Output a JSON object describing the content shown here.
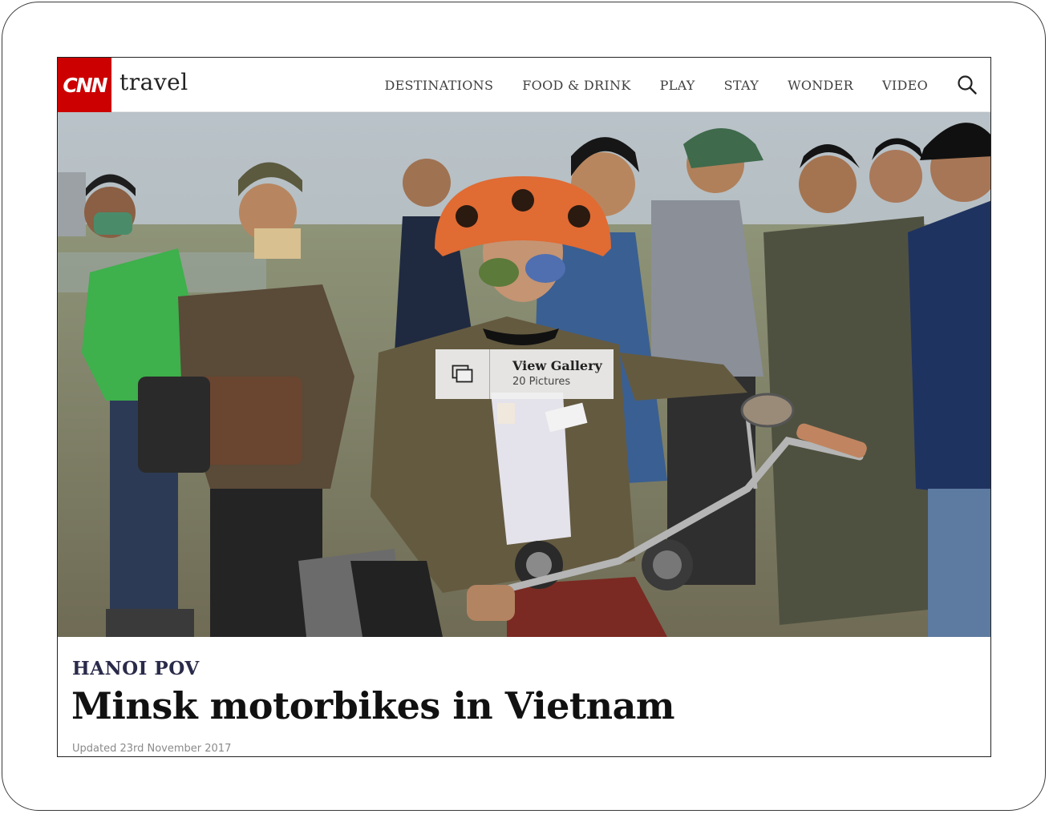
{
  "brand": {
    "logo_text": "CNN",
    "section_name": "travel",
    "accent_color": "#cc0000"
  },
  "nav": {
    "items": [
      {
        "label": "DESTINATIONS"
      },
      {
        "label": "FOOD & DRINK"
      },
      {
        "label": "PLAY"
      },
      {
        "label": "STAY"
      },
      {
        "label": "WONDER"
      },
      {
        "label": "VIDEO"
      }
    ],
    "search_icon": "search-icon"
  },
  "hero": {
    "gallery": {
      "icon": "gallery-icon",
      "title": "View Gallery",
      "count": "20 Pictures"
    }
  },
  "article": {
    "kicker": "HANOI POV",
    "kicker_color": "#2a2a4a",
    "headline": "Minsk motorbikes in Vietnam",
    "updated": "Updated 23rd November 2017"
  }
}
